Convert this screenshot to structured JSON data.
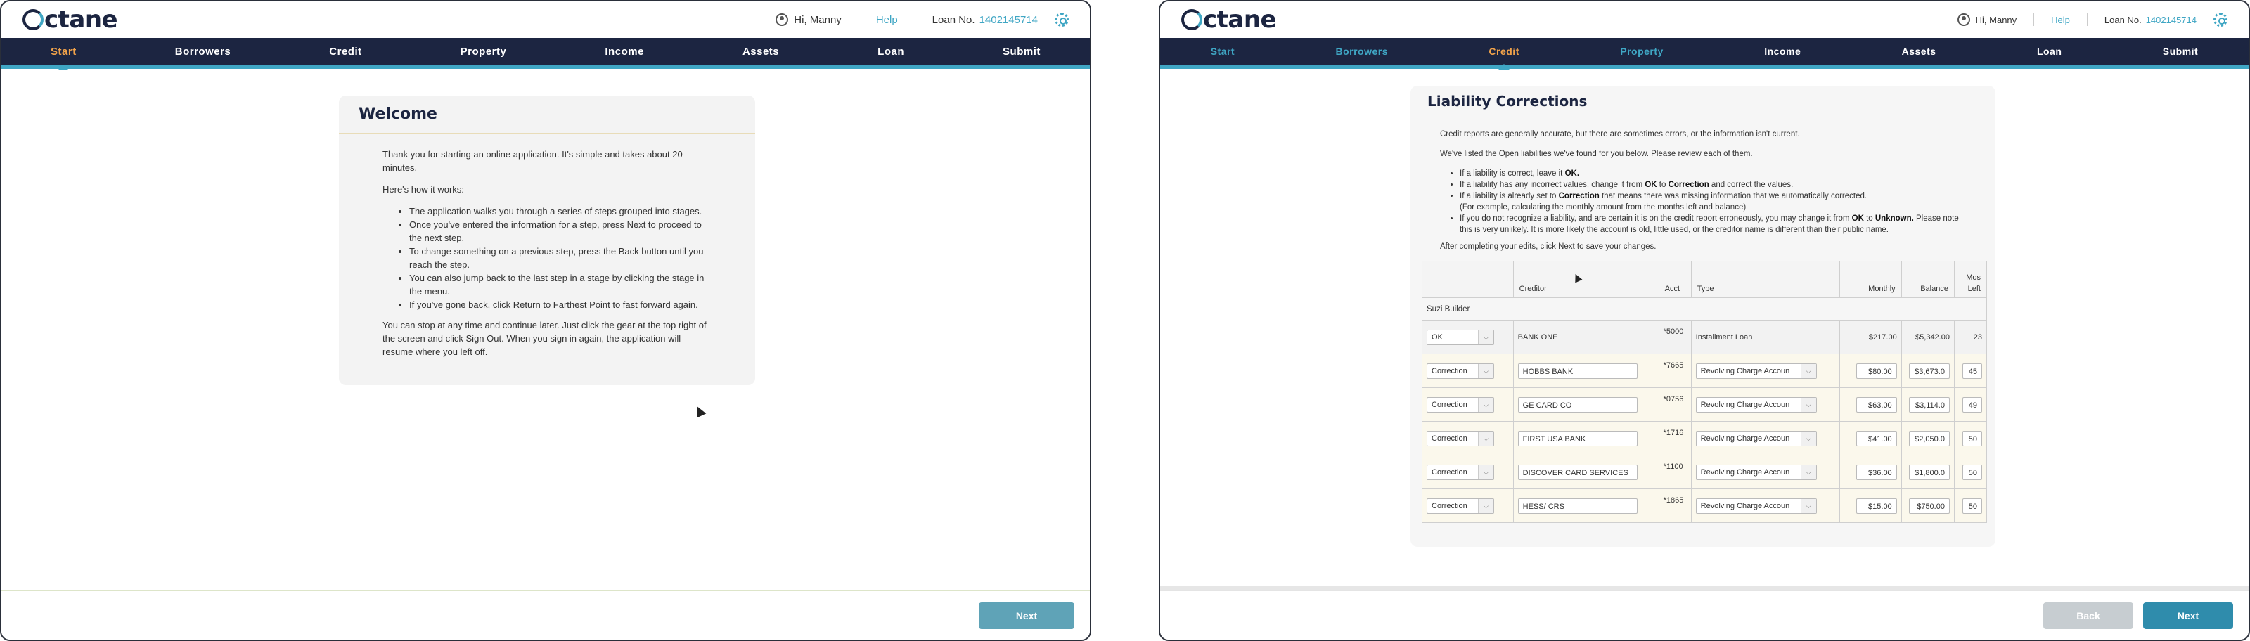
{
  "brand": "ctane",
  "user": {
    "greeting": "Hi, Manny",
    "help": "Help",
    "loan_label": "Loan No.",
    "loan_number": "1402145714"
  },
  "nav": [
    "Start",
    "Borrowers",
    "Credit",
    "Property",
    "Income",
    "Assets",
    "Loan",
    "Submit"
  ],
  "welcome": {
    "title": "Welcome",
    "intro": "Thank you for starting an online application. It's simple and takes about 20 minutes.",
    "how": "Here's how it works:",
    "steps": [
      "The application walks you through a series of steps grouped into stages.",
      "Once you've entered the information for a step, press Next to proceed to the next step.",
      "To change something on a previous step, press the Back button until you reach the step.",
      "You can also jump back to the last step in a stage by clicking the stage in the menu.",
      "If you've gone back, click Return to Farthest Point to fast forward again."
    ],
    "outro": "You can stop at any time and continue later. Just click the gear at the top right of the screen and click Sign Out. When you sign in again, the application will resume where you left off.",
    "next": "Next"
  },
  "liability": {
    "title": "Liability Corrections",
    "p1": "Credit reports are generally accurate, but there are sometimes errors, or the information isn't current.",
    "p2": "We've listed the Open liabilities we've found for you below. Please review each of them.",
    "b1_pre": "If a liability is correct, leave it ",
    "b1_bold": "OK.",
    "b2_pre": "If a liability has any incorrect values, change it from ",
    "b2_ok": "OK",
    "b2_mid": " to ",
    "b2_corr": "Correction",
    "b2_post": " and correct the values.",
    "b3_pre": "If a liability is already set to ",
    "b3_corr": "Correction",
    "b3_post": " that means there was missing information that we automatically corrected.",
    "b3_line2": "(For example, calculating the monthly amount from the months left and balance)",
    "b4_pre": "If you do not recognize a liability, and are certain it is on the credit report erroneously, you may change it from ",
    "b4_ok": "OK",
    "b4_mid": " to ",
    "b4_unk": "Unknown.",
    "b4_post": " Please note this is very unlikely. It is more likely the account is old, little used, or the creditor name is different than their public name.",
    "p3": "After completing your edits, click Next to save your changes.",
    "headers": {
      "creditor": "Creditor",
      "acct": "Acct",
      "type": "Type",
      "monthly": "Monthly",
      "balance": "Balance",
      "mos_left": "Mos Left"
    },
    "group": "Suzi Builder",
    "rows": [
      {
        "status": "OK",
        "creditor": "BANK ONE",
        "acct": "*5000",
        "type": "Installment Loan",
        "monthly": "$217.00",
        "balance": "$5,342.00",
        "mos": "23"
      },
      {
        "status": "Correction",
        "creditor": "HOBBS BANK",
        "acct": "*7665",
        "type": "Revolving Charge Accoun",
        "monthly": "$80.00",
        "balance": "$3,673.0",
        "mos": "45"
      },
      {
        "status": "Correction",
        "creditor": "GE CARD CO",
        "acct": "*0756",
        "type": "Revolving Charge Accoun",
        "monthly": "$63.00",
        "balance": "$3,114.0",
        "mos": "49"
      },
      {
        "status": "Correction",
        "creditor": "FIRST USA BANK",
        "acct": "*1716",
        "type": "Revolving Charge Accoun",
        "monthly": "$41.00",
        "balance": "$2,050.0",
        "mos": "50"
      },
      {
        "status": "Correction",
        "creditor": "DISCOVER CARD SERVICES",
        "acct": "*1100",
        "type": "Revolving Charge Accoun",
        "monthly": "$36.00",
        "balance": "$1,800.0",
        "mos": "50"
      },
      {
        "status": "Correction",
        "creditor": "HESS/ CRS",
        "acct": "*1865",
        "type": "Revolving Charge Accoun",
        "monthly": "$15.00",
        "balance": "$750.00",
        "mos": "50"
      }
    ],
    "back": "Back",
    "next": "Next"
  }
}
